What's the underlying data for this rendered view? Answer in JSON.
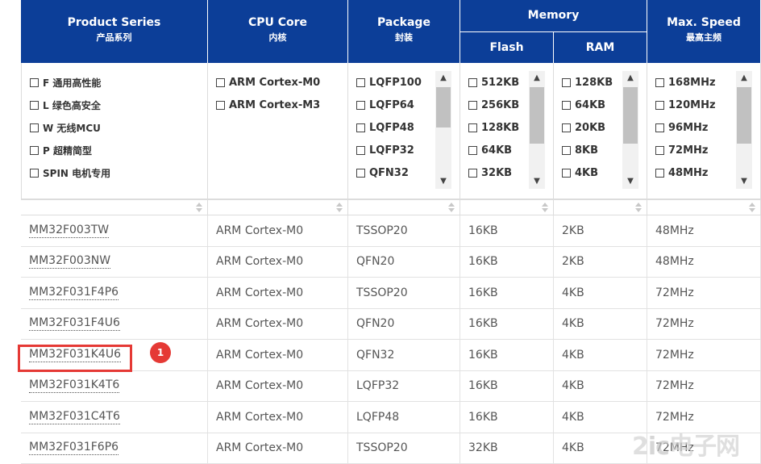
{
  "headers": {
    "product_series": {
      "en": "Product Series",
      "cn": "产品系列"
    },
    "cpu_core": {
      "en": "CPU Core",
      "cn": "内核"
    },
    "package": {
      "en": "Package",
      "cn": "封装"
    },
    "memory": {
      "label": "Memory",
      "flash": "Flash",
      "ram": "RAM"
    },
    "max_speed": {
      "en": "Max. Speed",
      "cn": "最高主频"
    }
  },
  "filters": {
    "product_series": [
      {
        "label": "F 通用高性能",
        "checked": false
      },
      {
        "label": "L 绿色高安全",
        "checked": false
      },
      {
        "label": "W 无线MCU",
        "checked": false
      },
      {
        "label": "P 超精简型",
        "checked": false
      },
      {
        "label": "SPIN 电机专用",
        "checked": false
      }
    ],
    "cpu_core": [
      {
        "label": "ARM Cortex-M0",
        "checked": false
      },
      {
        "label": "ARM Cortex-M3",
        "checked": false
      }
    ],
    "package": [
      {
        "label": "LQFP100",
        "checked": false
      },
      {
        "label": "LQFP64",
        "checked": false
      },
      {
        "label": "LQFP48",
        "checked": false
      },
      {
        "label": "LQFP32",
        "checked": false
      },
      {
        "label": "QFN32",
        "checked": false
      }
    ],
    "flash": [
      {
        "label": "512KB",
        "checked": false
      },
      {
        "label": "256KB",
        "checked": false
      },
      {
        "label": "128KB",
        "checked": false
      },
      {
        "label": "64KB",
        "checked": false
      },
      {
        "label": "32KB",
        "checked": false
      }
    ],
    "ram": [
      {
        "label": "128KB",
        "checked": false
      },
      {
        "label": "64KB",
        "checked": false
      },
      {
        "label": "20KB",
        "checked": false
      },
      {
        "label": "8KB",
        "checked": false
      },
      {
        "label": "4KB",
        "checked": false
      }
    ],
    "max_speed": [
      {
        "label": "168MHz",
        "checked": false
      },
      {
        "label": "120MHz",
        "checked": false
      },
      {
        "label": "96MHz",
        "checked": false
      },
      {
        "label": "72MHz",
        "checked": false
      },
      {
        "label": "48MHz",
        "checked": false
      }
    ]
  },
  "rows": [
    {
      "part": "MM32F003TW",
      "core": "ARM Cortex-M0",
      "package": "TSSOP20",
      "flash": "16KB",
      "ram": "2KB",
      "speed": "48MHz"
    },
    {
      "part": "MM32F003NW",
      "core": "ARM Cortex-M0",
      "package": "QFN20",
      "flash": "16KB",
      "ram": "2KB",
      "speed": "48MHz"
    },
    {
      "part": "MM32F031F4P6",
      "core": "ARM Cortex-M0",
      "package": "TSSOP20",
      "flash": "16KB",
      "ram": "4KB",
      "speed": "72MHz"
    },
    {
      "part": "MM32F031F4U6",
      "core": "ARM Cortex-M0",
      "package": "QFN20",
      "flash": "16KB",
      "ram": "4KB",
      "speed": "72MHz"
    },
    {
      "part": "MM32F031K4U6",
      "core": "ARM Cortex-M0",
      "package": "QFN32",
      "flash": "16KB",
      "ram": "4KB",
      "speed": "72MHz"
    },
    {
      "part": "MM32F031K4T6",
      "core": "ARM Cortex-M0",
      "package": "LQFP32",
      "flash": "16KB",
      "ram": "4KB",
      "speed": "72MHz"
    },
    {
      "part": "MM32F031C4T6",
      "core": "ARM Cortex-M0",
      "package": "LQFP48",
      "flash": "16KB",
      "ram": "4KB",
      "speed": "72MHz"
    },
    {
      "part": "MM32F031F6P6",
      "core": "ARM Cortex-M0",
      "package": "TSSOP20",
      "flash": "32KB",
      "ram": "4KB",
      "speed": "72MHz"
    }
  ],
  "annotation": {
    "marker": "1",
    "color": "#e53935"
  },
  "watermark": {
    "text_a": "2",
    "text_b": "ic",
    "text_c": "电子网"
  },
  "colors": {
    "header_bg": "#0c3e98",
    "header_text": "#ffffff"
  }
}
